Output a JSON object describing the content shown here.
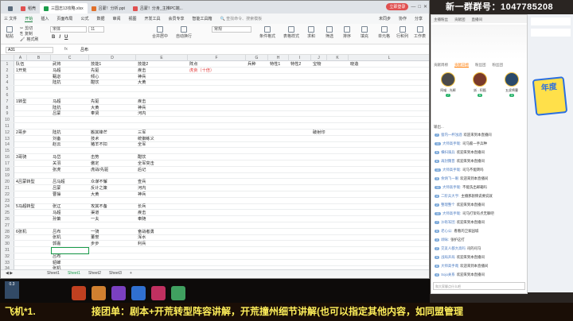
{
  "window": {
    "tabs": [
      {
        "label": "稻壳",
        "icon_color": "#e05050"
      },
      {
        "label": "三国志13攻略.xlsx",
        "icon_color": "#1a9d4a"
      },
      {
        "label": "吕蒙！分析.ppt",
        "icon_color": "#e0702a"
      },
      {
        "label": "吕蒙！分身_主推PC端...",
        "icon_color": "#e05050"
      }
    ],
    "signin": "立即登录"
  },
  "menu": {
    "file": "三 文件",
    "items": [
      "开始",
      "插入",
      "页面布局",
      "公式",
      "数据",
      "审阅",
      "视图",
      "开发工具",
      "会员专享",
      "智能工具箱"
    ],
    "search": "查找命令、搜索模板",
    "collab": "未同步",
    "share": "协作",
    "share2": "分享"
  },
  "toolbar": {
    "paste": "粘贴",
    "cut": "剪切",
    "copy": "复制",
    "format_painter": "格式刷",
    "font": "宋体",
    "font_size": "11",
    "merge": "合并居中",
    "wrap": "自动换行",
    "number_format": "常规",
    "cond_format": "条件格式",
    "table_style": "表格样式",
    "sum": "求和",
    "filter": "筛选",
    "sort": "排序",
    "fill": "填充",
    "cell": "单元格",
    "rowcol": "行和列",
    "sheet": "工作表"
  },
  "formula": {
    "cell_ref": "A31",
    "fx": "fx",
    "value": "吕布"
  },
  "columns": [
    "A",
    "B",
    "C",
    "D",
    "E",
    "F",
    "G",
    "H",
    "I",
    "J",
    "K",
    "L"
  ],
  "rows": [
    {
      "n": "1",
      "a": "队伍",
      "b": "武将",
      "c": "技能1",
      "d": "技能2",
      "e": "阵点",
      "f": "兵种",
      "g": "特性1",
      "h": "特性2",
      "i": "宝物",
      "j": "",
      "k": "晓造",
      "red": ""
    },
    {
      "n": "2",
      "a": "1开荒",
      "b": "马超",
      "c": "先驱",
      "d": "疾击",
      "e": "",
      "f": "",
      "g": "",
      "h": "",
      "i": "",
      "j": "",
      "k": "",
      "red": "虎贲（十倍）"
    },
    {
      "n": "3",
      "a": "",
      "b": "甄宓",
      "c": "倾心",
      "d": "神兵",
      "e": "",
      "f": "",
      "g": "",
      "h": "",
      "i": "",
      "j": "",
      "k": "",
      "red": ""
    },
    {
      "n": "4",
      "a": "",
      "b": "陆抗",
      "c": "酣饮",
      "d": "大黄",
      "e": "",
      "f": "",
      "g": "",
      "h": "",
      "i": "",
      "j": "",
      "k": "",
      "red": ""
    },
    {
      "n": "5",
      "a": "",
      "b": "",
      "c": "",
      "d": "",
      "e": "",
      "f": "",
      "g": "",
      "h": "",
      "i": "",
      "j": "",
      "k": "",
      "red": ""
    },
    {
      "n": "6",
      "a": "",
      "b": "",
      "c": "",
      "d": "",
      "e": "",
      "f": "",
      "g": "",
      "h": "",
      "i": "",
      "j": "",
      "k": "",
      "red": ""
    },
    {
      "n": "7",
      "a": "1转型",
      "b": "马超",
      "c": "先驱",
      "d": "疾击",
      "e": "",
      "f": "",
      "g": "",
      "h": "",
      "i": "",
      "j": "",
      "k": "",
      "red": ""
    },
    {
      "n": "8",
      "a": "",
      "b": "陆抗",
      "c": "大黄",
      "d": "神兵",
      "e": "",
      "f": "",
      "g": "",
      "h": "",
      "i": "",
      "j": "",
      "k": "",
      "red": ""
    },
    {
      "n": "9",
      "a": "",
      "b": "吕蒙",
      "c": "奉贤",
      "d": "河内",
      "e": "",
      "f": "",
      "g": "",
      "h": "",
      "i": "",
      "j": "",
      "k": "",
      "red": ""
    },
    {
      "n": "10",
      "a": "",
      "b": "",
      "c": "",
      "d": "",
      "e": "",
      "f": "",
      "g": "",
      "h": "",
      "i": "",
      "j": "",
      "k": "",
      "red": ""
    },
    {
      "n": "11",
      "a": "",
      "b": "",
      "c": "",
      "d": "",
      "e": "",
      "f": "",
      "g": "",
      "h": "",
      "i": "",
      "j": "",
      "k": "",
      "red": ""
    },
    {
      "n": "12",
      "a": "2哥步",
      "b": "陆抗",
      "c": "搬其锋芒",
      "d": "三军",
      "e": "",
      "f": "",
      "g": "",
      "h": "",
      "i": "破射印",
      "j": "",
      "k": "",
      "red": ""
    },
    {
      "n": "13",
      "a": "",
      "b": "刘备",
      "c": "技术",
      "d": "统御练义",
      "e": "",
      "f": "",
      "g": "",
      "h": "",
      "i": "",
      "j": "",
      "k": "",
      "red": ""
    },
    {
      "n": "14",
      "a": "",
      "b": "赵云",
      "c": "猪羊不扣",
      "d": "全军",
      "e": "",
      "f": "",
      "g": "",
      "h": "",
      "i": "",
      "j": "",
      "k": "",
      "red": ""
    },
    {
      "n": "15",
      "a": "",
      "b": "",
      "c": "",
      "d": "",
      "e": "",
      "f": "",
      "g": "",
      "h": "",
      "i": "",
      "j": "",
      "k": "",
      "red": ""
    },
    {
      "n": "16",
      "a": "3哥骑",
      "b": "马岱",
      "c": "击势",
      "d": "酣饮",
      "e": "",
      "f": "",
      "g": "",
      "h": "",
      "i": "",
      "j": "",
      "k": "",
      "red": ""
    },
    {
      "n": "17",
      "a": "",
      "b": "关羽",
      "c": "傲定",
      "d": "全军突击",
      "e": "",
      "f": "",
      "g": "",
      "h": "",
      "i": "",
      "j": "",
      "k": "",
      "red": ""
    },
    {
      "n": "18",
      "a": "",
      "b": "张虎",
      "c": "虎战/先驱",
      "d": "后记",
      "e": "",
      "f": "",
      "g": "",
      "h": "",
      "i": "",
      "j": "",
      "k": "",
      "red": ""
    },
    {
      "n": "19",
      "a": "",
      "b": "",
      "c": "",
      "d": "",
      "e": "",
      "f": "",
      "g": "",
      "h": "",
      "i": "",
      "j": "",
      "k": "",
      "red": ""
    },
    {
      "n": "20",
      "a": "4吕蒙转型",
      "b": "吕马超",
      "c": "众谋不懈",
      "d": "查兵",
      "e": "",
      "f": "",
      "g": "",
      "h": "",
      "i": "",
      "j": "",
      "k": "",
      "red": ""
    },
    {
      "n": "21",
      "a": "",
      "b": "吕蒙",
      "c": "反计之策",
      "d": "河内",
      "e": "",
      "f": "",
      "g": "",
      "h": "",
      "i": "",
      "j": "",
      "k": "",
      "red": ""
    },
    {
      "n": "22",
      "a": "",
      "b": "曹操",
      "c": "大黄",
      "d": "神兵",
      "e": "",
      "f": "",
      "g": "",
      "h": "",
      "i": "",
      "j": "",
      "k": "",
      "red": ""
    },
    {
      "n": "23",
      "a": "",
      "b": "",
      "c": "",
      "d": "",
      "e": "",
      "f": "",
      "g": "",
      "h": "",
      "i": "",
      "j": "",
      "k": "",
      "red": ""
    },
    {
      "n": "24",
      "a": "5马超转型",
      "b": "张辽",
      "c": "攻其不备",
      "d": "长兵",
      "e": "",
      "f": "",
      "g": "",
      "h": "",
      "i": "",
      "j": "",
      "k": "",
      "red": ""
    },
    {
      "n": "25",
      "a": "",
      "b": "马超",
      "c": "渠道",
      "d": "疾击",
      "e": "",
      "f": "",
      "g": "",
      "h": "",
      "i": "",
      "j": "",
      "k": "",
      "red": ""
    },
    {
      "n": "26",
      "a": "",
      "b": "孙策",
      "c": "一夫",
      "d": "奉随",
      "e": "",
      "f": "",
      "g": "",
      "h": "",
      "i": "",
      "j": "",
      "k": "",
      "red": ""
    },
    {
      "n": "27",
      "a": "",
      "b": "",
      "c": "",
      "d": "",
      "e": "",
      "f": "",
      "g": "",
      "h": "",
      "i": "",
      "j": "",
      "k": "",
      "red": ""
    },
    {
      "n": "28",
      "a": "6张机",
      "b": "吕布",
      "c": "一骑",
      "d": "奋战者勇",
      "e": "",
      "f": "",
      "g": "",
      "h": "",
      "i": "",
      "j": "",
      "k": "",
      "red": ""
    },
    {
      "n": "29",
      "a": "",
      "b": "张机",
      "c": "董誉",
      "d": "浑水",
      "e": "",
      "f": "",
      "g": "",
      "h": "",
      "i": "",
      "j": "",
      "k": "",
      "red": ""
    },
    {
      "n": "30",
      "a": "",
      "b": "郭嘉",
      "c": "步步",
      "d": "利兵",
      "e": "",
      "f": "",
      "g": "",
      "h": "",
      "i": "",
      "j": "",
      "k": "",
      "red": ""
    },
    {
      "n": "31",
      "a": "",
      "b": "",
      "c": "",
      "d": "",
      "e": "",
      "f": "",
      "g": "",
      "h": "",
      "i": "",
      "j": "",
      "k": "",
      "red": ""
    },
    {
      "n": "32",
      "a": "",
      "b": "吕布",
      "c": "",
      "d": "",
      "e": "",
      "f": "",
      "g": "",
      "h": "",
      "i": "",
      "j": "",
      "k": "",
      "red": ""
    },
    {
      "n": "33",
      "a": "",
      "b": "貂蝉",
      "c": "",
      "d": "",
      "e": "",
      "f": "",
      "g": "",
      "h": "",
      "i": "",
      "j": "",
      "k": "",
      "red": ""
    },
    {
      "n": "34",
      "a": "",
      "b": "张机",
      "c": "",
      "d": "",
      "e": "",
      "f": "",
      "g": "",
      "h": "",
      "i": "",
      "j": "",
      "k": "",
      "red": ""
    }
  ],
  "sheets": [
    "Sheet1",
    "Sheet1",
    "Sheet2",
    "Sheet3"
  ],
  "active_sheet_index": 1,
  "stream": {
    "qq_group": "新一群群号：1047785208",
    "anchor_tabs": [
      "主播粉丝",
      "贡献团",
      "直播间"
    ],
    "subtabs": [
      "贡献周榜",
      "贡献日榜",
      "粉丝团",
      "粉丝团"
    ],
    "fans": [
      {
        "name": "阿喵 - 光辉",
        "badge": "7"
      },
      {
        "name": "妖 - 阿甄",
        "badge": "5"
      },
      {
        "name": "五虎将曹",
        "badge": "3"
      }
    ],
    "feed_header": "输出...",
    "messages": [
      {
        "level": "7",
        "name": "窗内一杯浊酒",
        "text": "欢迎来到本直播间"
      },
      {
        "level": "11",
        "name": "大师高手哉:",
        "text": "司马懿一手兵种"
      },
      {
        "level": "5",
        "name": "横扫骑兵",
        "text": "欢迎来到本直播间"
      },
      {
        "level": "6",
        "name": "再封魏晋",
        "text": "欢迎来到本直播间"
      },
      {
        "level": "11",
        "name": "大师高手哉:",
        "text": "司马不能转吗"
      },
      {
        "level": "3",
        "name": "余炳飞一眼",
        "text": "欢迎来到本直播间"
      },
      {
        "level": "11",
        "name": "大师高手哉:",
        "text": "不能洗出邮箱吗"
      },
      {
        "level": "4",
        "name": "二阶兵大亨:",
        "text": "主播那剧情说要说就"
      },
      {
        "level": "2",
        "name": "整理整个",
        "text": "欢迎来到本直播间"
      },
      {
        "level": "11",
        "name": "大师高手哉:",
        "text": "司马打架有点无聊吧"
      },
      {
        "level": "7",
        "name": "沙砾军团",
        "text": "欢迎来到本直播间"
      },
      {
        "level": "5",
        "name": "老心公:",
        "text": "看看的卫家园城"
      },
      {
        "level": "3",
        "name": "顽咏:",
        "text": "张护这打"
      },
      {
        "level": "2",
        "name": "交友人都大高吗",
        "text": "司的司马"
      },
      {
        "level": "9",
        "name": "战局开局",
        "text": "欢迎来到本直播间"
      },
      {
        "level": "6",
        "name": "大师高手哉",
        "text": "欢迎来到本直播间"
      },
      {
        "level": "4",
        "name": "Sojo关系",
        "text": "欢迎来到本直播间"
      }
    ],
    "chat_placeholder": "和大家聊点什么吧",
    "year_label": "年度",
    "countdown": "0.3"
  },
  "banner": {
    "left": "飞机*1.",
    "main": "接团单：剧本+开荒转型阵容讲解，开荒撞州细节讲解(也可以指定其他内容，如同盟管理"
  }
}
